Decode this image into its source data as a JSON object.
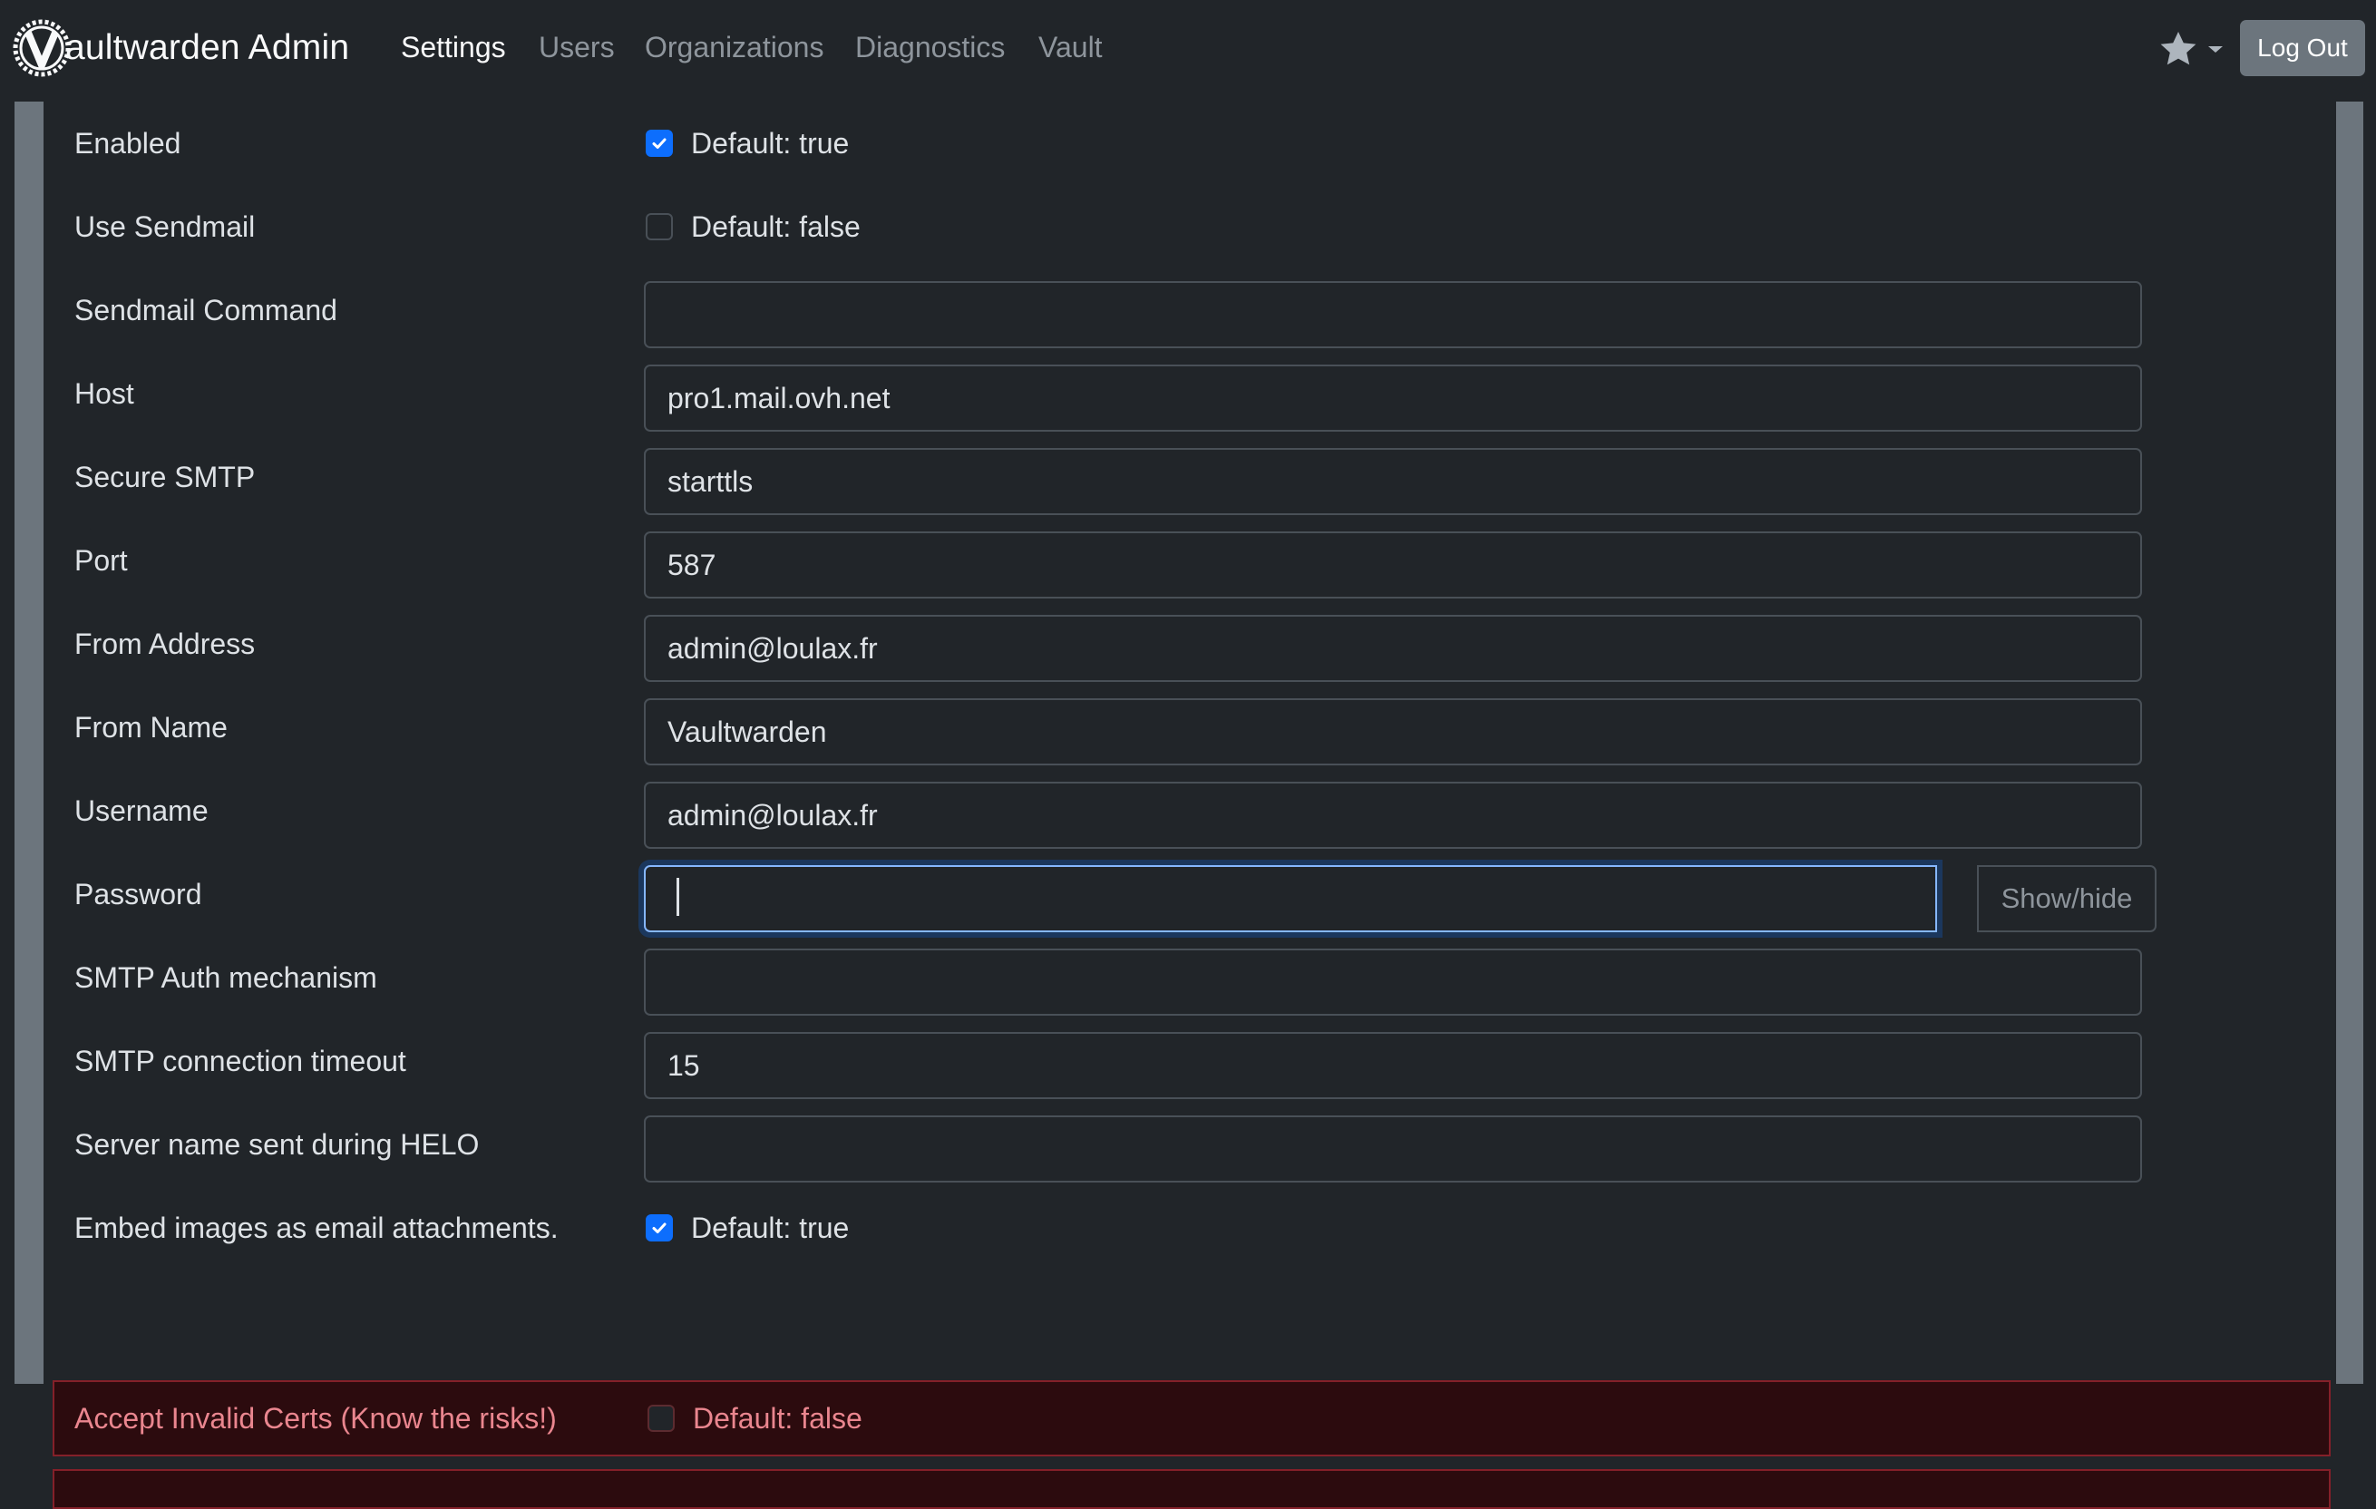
{
  "navbar": {
    "brand": "aultwarden Admin",
    "links": [
      "Settings",
      "Users",
      "Organizations",
      "Diagnostics",
      "Vault"
    ],
    "active": "Settings",
    "logout": "Log Out",
    "star_icon": "star-icon"
  },
  "smtp": {
    "enabled": {
      "label": "Enabled",
      "hint": "Default: true",
      "checked": true
    },
    "use_sendmail": {
      "label": "Use Sendmail",
      "hint": "Default: false",
      "checked": false
    },
    "sendmail_command": {
      "label": "Sendmail Command",
      "value": ""
    },
    "host": {
      "label": "Host",
      "value": "pro1.mail.ovh.net"
    },
    "secure_smtp": {
      "label": "Secure SMTP",
      "value": "starttls"
    },
    "port": {
      "label": "Port",
      "value": "587"
    },
    "from_address": {
      "label": "From Address",
      "value": "admin@loulax.fr"
    },
    "from_name": {
      "label": "From Name",
      "value": "Vaultwarden"
    },
    "username": {
      "label": "Username",
      "value": "admin@loulax.fr"
    },
    "password": {
      "label": "Password",
      "value": "",
      "toggle": "Show/hide"
    },
    "auth_mechanism": {
      "label": "SMTP Auth mechanism",
      "value": ""
    },
    "timeout": {
      "label": "SMTP connection timeout",
      "value": "15"
    },
    "helo_name": {
      "label": "Server name sent during HELO",
      "value": ""
    },
    "embed_images": {
      "label": "Embed images as email attachments.",
      "hint": "Default: true",
      "checked": true
    },
    "accept_invalid_certs": {
      "label": "Accept Invalid Certs (Know the risks!)",
      "hint": "Default: false",
      "checked": false
    }
  },
  "colors": {
    "accent": "#0d6efd",
    "danger_text": "#ea868f",
    "danger_bg": "#2c0b0e",
    "danger_border": "#842029"
  }
}
